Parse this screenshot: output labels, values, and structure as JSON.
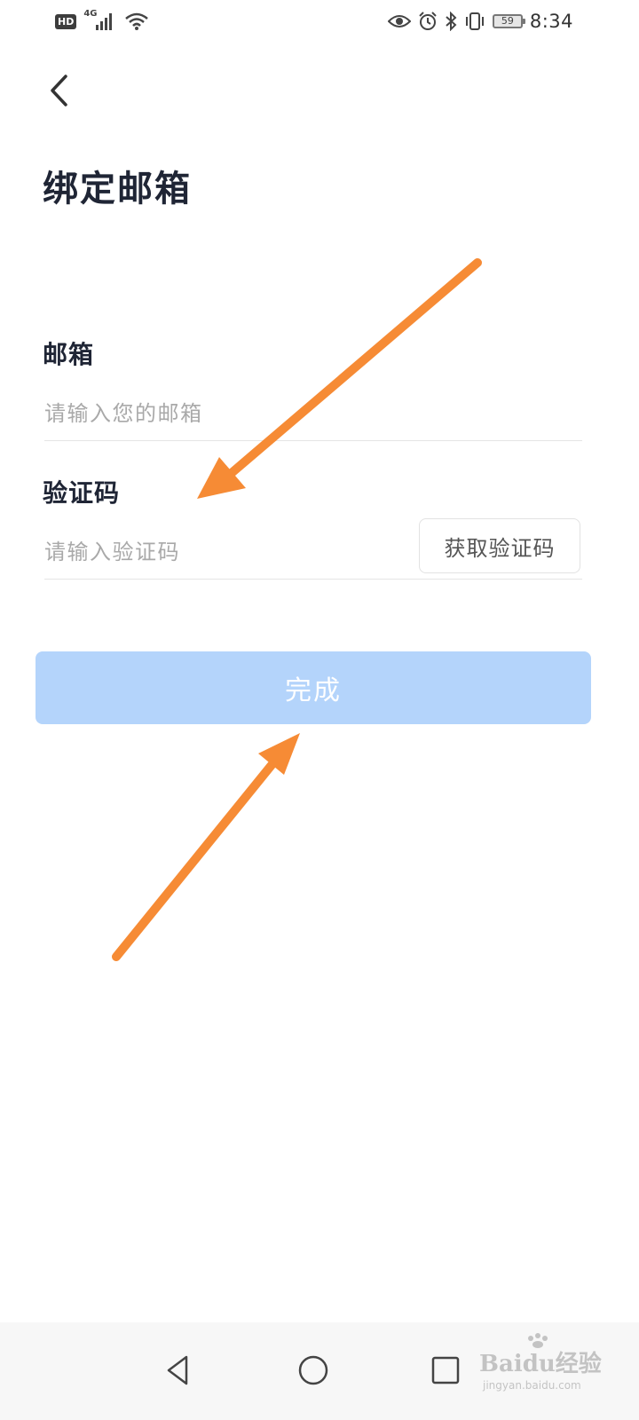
{
  "status_bar": {
    "hd_badge": "HD",
    "network": "4G",
    "battery": "59",
    "time": "8:34"
  },
  "header": {
    "back_icon": "chevron-left-icon",
    "title": "绑定邮箱"
  },
  "form": {
    "email_label": "邮箱",
    "email_placeholder": "请输入您的邮箱",
    "email_value": "",
    "code_label": "验证码",
    "code_placeholder": "请输入验证码",
    "code_value": "",
    "get_code_label": "获取验证码"
  },
  "submit": {
    "label": "完成",
    "enabled": false,
    "color": "#b4d4fb"
  },
  "annotations": {
    "arrow_color": "#f68b35"
  },
  "nav_bar": {
    "back_icon": "triangle-back-icon",
    "home_icon": "circle-home-icon",
    "recent_icon": "square-recent-icon"
  },
  "watermark": {
    "main": "Baidu经验",
    "sub": "jingyan.baidu.com"
  }
}
